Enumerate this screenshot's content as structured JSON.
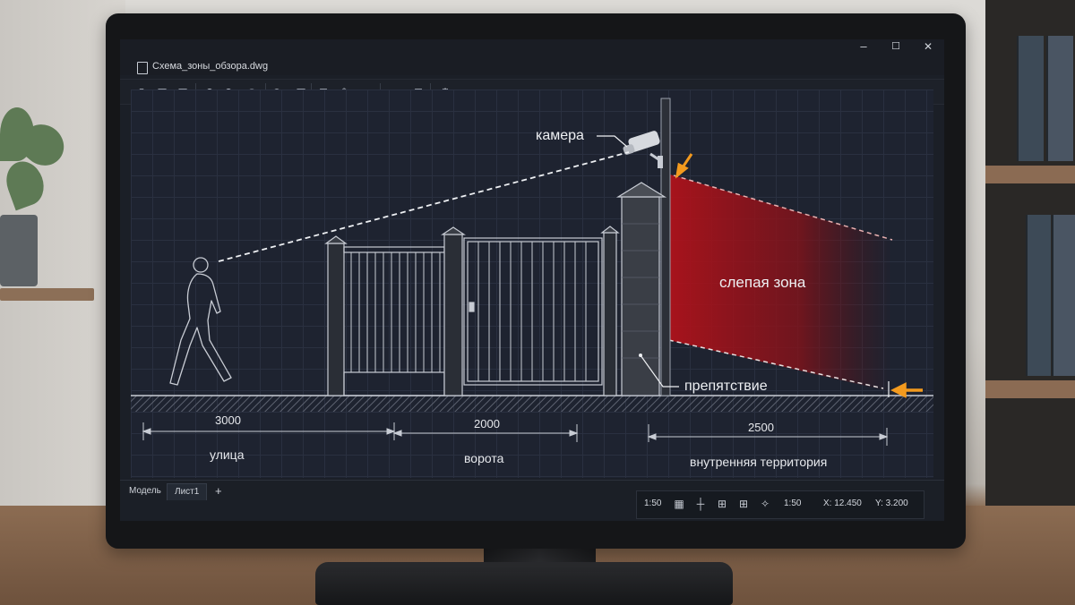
{
  "window": {
    "title": "Схема_зоны_обзора.dwg",
    "controls": {
      "minimize": "–",
      "maximize": "☐",
      "close": "✕"
    }
  },
  "toolbar": {
    "buttons": [
      {
        "name": "new-file-icon",
        "glyph": "▯"
      },
      {
        "name": "open-file-icon",
        "glyph": "▣"
      },
      {
        "name": "save-icon",
        "glyph": "▤"
      },
      {
        "name": "undo-icon",
        "glyph": "↶"
      },
      {
        "name": "redo-icon",
        "glyph": "↷"
      },
      {
        "name": "redo-all-icon",
        "glyph": "↷"
      },
      {
        "name": "target-icon",
        "glyph": "◉"
      },
      {
        "name": "layer-icon",
        "glyph": "▣"
      },
      {
        "name": "image-frame-icon",
        "glyph": "⊡"
      },
      {
        "name": "edit-icon",
        "glyph": "✎"
      },
      {
        "name": "pencil-icon",
        "glyph": "✏"
      },
      {
        "name": "camera-icon",
        "glyph": "◘"
      },
      {
        "name": "export-icon",
        "glyph": "⊞"
      },
      {
        "name": "settings-icon",
        "glyph": "⚙"
      }
    ]
  },
  "drawing": {
    "labels": {
      "camera": "камера",
      "blind_zone": "слепая зона",
      "obstacle": "препятствие"
    },
    "dimensions": [
      {
        "value": "3000",
        "caption": "улица"
      },
      {
        "value": "2000",
        "caption": "ворота"
      },
      {
        "value": "2500",
        "caption": "внутренняя территория"
      }
    ],
    "colors": {
      "blind_zone": "#b3121b",
      "arrow": "#f39a1e",
      "line": "#e8eaee",
      "grid": "#2a3040"
    }
  },
  "tabs": {
    "model": "Модель",
    "sheet": "Лист1",
    "add": "+"
  },
  "status": {
    "scale_left": "1:50",
    "scale_right": "1:50",
    "x_coord": "X: 12.450",
    "y_coord": "Y: 3.200",
    "icons": [
      "grid-icon",
      "snap-icon",
      "ortho-icon",
      "grid-alt-icon",
      "polar-icon"
    ]
  }
}
